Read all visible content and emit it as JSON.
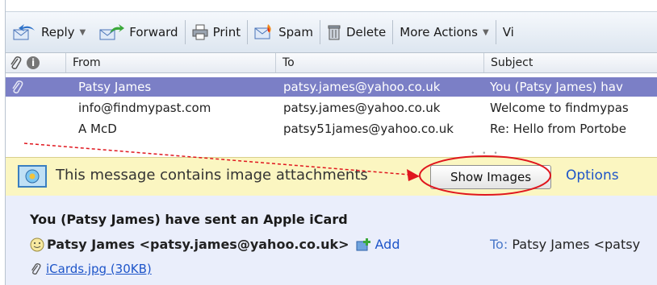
{
  "toolbar": {
    "reply": "Reply",
    "forward": "Forward",
    "print": "Print",
    "spam": "Spam",
    "delete": "Delete",
    "more_actions": "More Actions",
    "cut_off": "Vi"
  },
  "list": {
    "columns": {
      "from": "From",
      "to": "To",
      "subject": "Subject"
    },
    "rows": [
      {
        "from": "Patsy James",
        "to": "patsy.james@yahoo.co.uk",
        "subject": "You (Patsy James) hav",
        "selected": true
      },
      {
        "from": "info@findmypast.com",
        "to": "patsy.james@yahoo.co.uk",
        "subject": "Welcome to findmypas",
        "selected": false
      },
      {
        "from": "A McD",
        "to": "patsy51james@yahoo.co.uk",
        "subject": "Re: Hello from Portobe",
        "selected": false
      }
    ]
  },
  "notice": {
    "text": "This message contains image attachments",
    "show_images": "Show Images",
    "options": "Options"
  },
  "preview": {
    "subject": "You (Patsy James) have sent an Apple iCard",
    "from": "Patsy James <patsy.james@yahoo.co.uk>",
    "add": "Add",
    "to_label": "To:",
    "to_value": "Patsy James <patsy",
    "attachment": "iCards.jpg (30KB)"
  },
  "colors": {
    "selected_row": "#7b7fc6",
    "notice_bg": "#fbf6c1",
    "preview_bg": "#eaeefb",
    "link": "#1e55c9",
    "annotation": "#e0161e"
  }
}
